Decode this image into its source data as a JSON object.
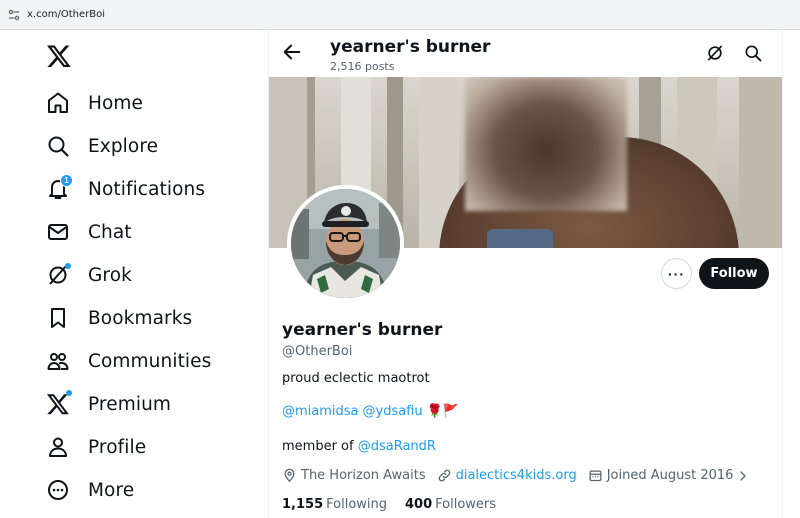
{
  "browser": {
    "url": "x.com/OtherBoi"
  },
  "sidebar": {
    "items": [
      {
        "label": "Home",
        "icon": "home-icon"
      },
      {
        "label": "Explore",
        "icon": "search-icon"
      },
      {
        "label": "Notifications",
        "icon": "bell-icon",
        "badge": "1"
      },
      {
        "label": "Chat",
        "icon": "mail-icon"
      },
      {
        "label": "Grok",
        "icon": "grok-icon"
      },
      {
        "label": "Bookmarks",
        "icon": "bookmark-icon"
      },
      {
        "label": "Communities",
        "icon": "communities-icon"
      },
      {
        "label": "Premium",
        "icon": "x-logo-icon"
      },
      {
        "label": "Profile",
        "icon": "person-icon"
      },
      {
        "label": "More",
        "icon": "more-circle-icon"
      }
    ]
  },
  "header": {
    "title": "yearner's burner",
    "post_count": "2,516 posts"
  },
  "profile": {
    "name": "yearner's burner",
    "handle": "@OtherBoi",
    "bio_line1": "proud eclectic maotrot",
    "bio_mention1": "@miamidsa",
    "bio_mention2": "@ydsafiu",
    "bio_emojis": "🌹🚩",
    "bio_member_prefix": "member of ",
    "bio_member_link": "@dsaRandR",
    "location": "The Horizon Awaits",
    "website": "dialectics4kids.org",
    "joined": "Joined August 2016",
    "following_count": "1,155",
    "following_label": "Following",
    "followers_count": "400",
    "followers_label": "Followers"
  },
  "actions": {
    "follow_label": "Follow",
    "more_label": "···"
  },
  "colors": {
    "accent": "#1d9bf0",
    "text": "#0f1419",
    "secondary": "#536471"
  }
}
